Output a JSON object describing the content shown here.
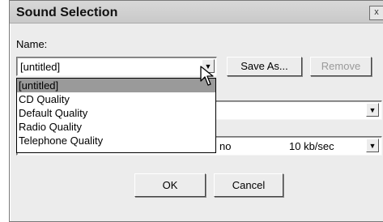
{
  "dialog": {
    "title": "Sound Selection",
    "close_glyph": "x"
  },
  "name_field": {
    "label": "Name:",
    "value": "[untitled]",
    "arrow_glyph": "▼"
  },
  "buttons": {
    "save_as": "Save As...",
    "remove": "Remove",
    "ok": "OK",
    "cancel": "Cancel"
  },
  "dropdown_options": [
    "[untitled]",
    "CD Quality",
    "Default Quality",
    "Radio Quality",
    "Telephone Quality"
  ],
  "format_combo": {
    "value": "",
    "arrow_glyph": "▼"
  },
  "attributes_combo": {
    "channels_fragment": "no",
    "rate": "10 kb/sec",
    "arrow_glyph": "▼"
  }
}
